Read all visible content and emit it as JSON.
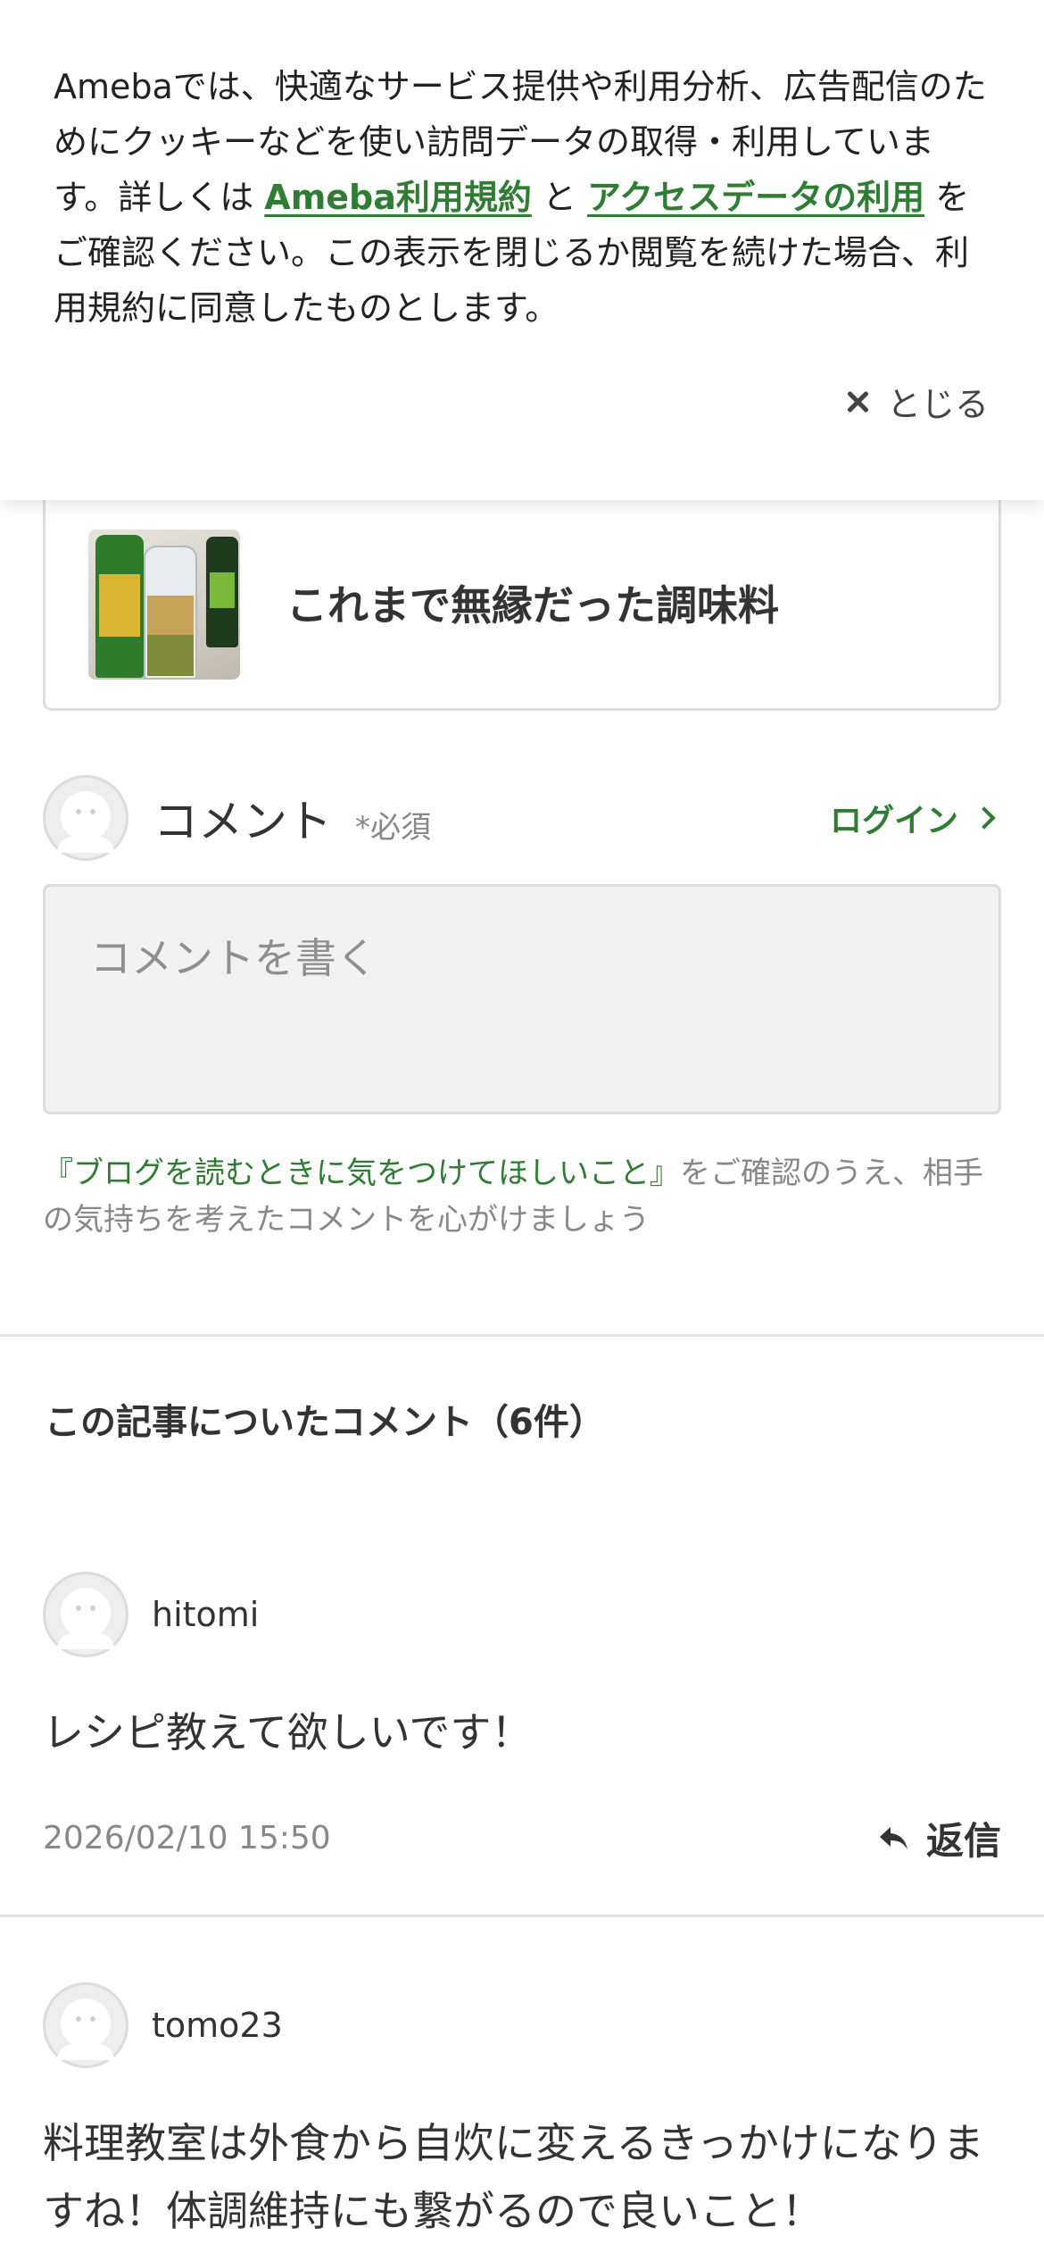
{
  "cookie_banner": {
    "text_before": "Amebaでは、快適なサービス提供や利用分析、広告配信のためにクッキーなどを使い訪問データの取得・利用しています。詳しくは ",
    "link_terms": "Ameba利用規約",
    "text_and": " と ",
    "link_access_data": "アクセスデータの利用",
    "text_after": " をご確認ください。この表示を閉じるか閲覧を続けた場合、利用規約に同意したものとします。",
    "close_label": "とじる"
  },
  "related_article": {
    "title": "これまで無縁だった調味料"
  },
  "comment_form": {
    "label": "コメント",
    "required": "*必須",
    "login_label": "ログイン",
    "placeholder": "コメントを書く",
    "note_link": "『ブログを読むときに気をつけてほしいこと』",
    "note_text": "をご確認のうえ、相手の気持ちを考えたコメントを心がけましょう"
  },
  "comments_section": {
    "title": "この記事についたコメント（6件）",
    "items": [
      {
        "user": "hitomi",
        "text": "レシピ教えて欲しいです！",
        "date": "2026/02/10 15:50",
        "reply_label": "返信"
      },
      {
        "user": "tomo23",
        "text": "料理教室は外食から自炊に変えるきっかけになりますね！体調維持にも繋がるので良いこと！"
      }
    ]
  },
  "colors": {
    "accent": "#2e7d32",
    "text": "#333333",
    "muted": "#888888"
  }
}
